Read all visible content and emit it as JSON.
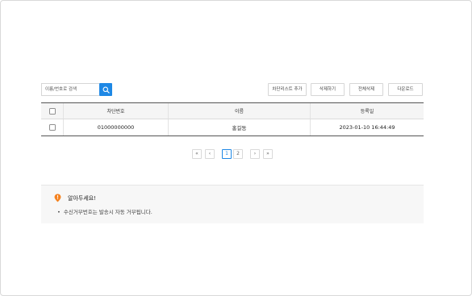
{
  "toolbar": {
    "search_placeholder": "이름/번호로 검색",
    "buttons": {
      "add_blocklist": "차단리스트 추가",
      "delete": "삭제하기",
      "delete_all": "전체삭제",
      "download": "다운로드"
    }
  },
  "table": {
    "headers": [
      "차단번호",
      "이름",
      "등록일"
    ],
    "rows": [
      {
        "number": "01000000000",
        "name": "홍길동",
        "date": "2023-01-10 16:44:49"
      }
    ]
  },
  "pagination": {
    "first": "«",
    "prev": "‹",
    "pages": [
      "1",
      "2"
    ],
    "current": "1",
    "next": "›",
    "last": "»"
  },
  "notice": {
    "title": "알아두세요!",
    "items": [
      "수신거부번호는 발송시 자동 거부됩니다."
    ]
  },
  "colors": {
    "accent": "#1e88e5",
    "notice_icon": "#f5821f"
  },
  "icons": {
    "search": "search-icon",
    "notice": "warning-pin-icon"
  }
}
